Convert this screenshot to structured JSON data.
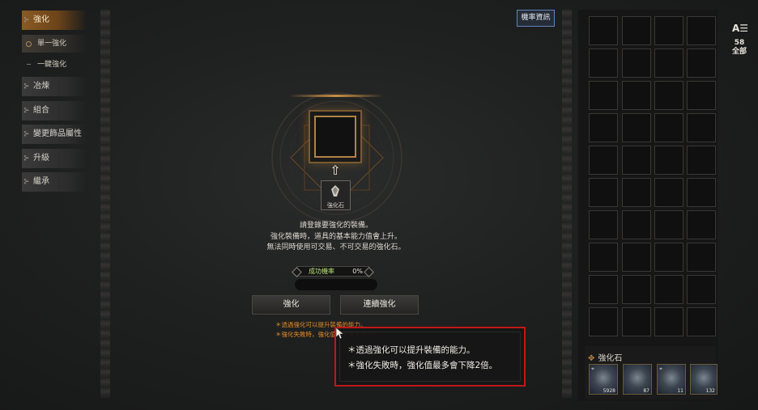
{
  "menu": {
    "enhance": "強化",
    "single_enhance": "單一強化",
    "one_click_enhance": "一鍵強化",
    "refine": "冶煉",
    "combine": "組合",
    "change_accessory": "變更飾品屬性",
    "upgrade": "升級",
    "inherit": "繼承"
  },
  "rate_info_button": "機率資訊",
  "center": {
    "stone_label": "強化石",
    "desc_1": "請登錄要強化的裝備。",
    "desc_2": "強化裝備時，道具的基本能力值會上升。",
    "desc_3": "無法同時使用可交易、不可交易的強化石。",
    "success_rate_label": "成功機率",
    "success_rate_value": "0%",
    "enhance_button": "強化",
    "continuous_enhance_button": "連續強化",
    "tip_1": "＊透過強化可以提升裝備的能力。",
    "tip_2": "＊強化失敗時，強化值最多會下降2倍。"
  },
  "inventory": {
    "sort_label": "A☰",
    "count": "58",
    "filter": "全部",
    "stone_section_title": "強化石",
    "stones": [
      {
        "qty": "5928"
      },
      {
        "qty": "87"
      },
      {
        "qty": "11"
      },
      {
        "qty": "132"
      }
    ]
  },
  "tooltip": {
    "line_1": "＊透過強化可以提升裝備的能力。",
    "line_2": "＊強化失敗時，強化值最多會下降2倍。"
  },
  "colors": {
    "accent_gold": "#c98f44",
    "tooltip_border": "#c01818",
    "success_green": "#b8e07a",
    "tip_orange": "#e08a2a",
    "rate_button_border": "#5f84c0"
  }
}
